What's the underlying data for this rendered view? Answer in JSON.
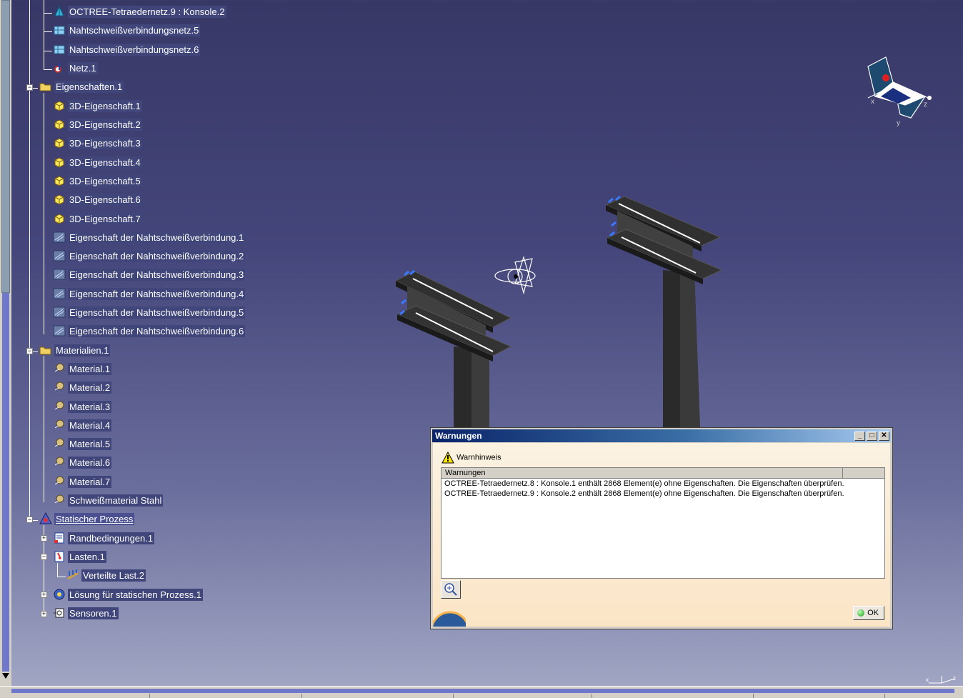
{
  "tree": {
    "items": [
      {
        "label": "OCTREE-Tetraedernetz.9 : Konsole.2",
        "icon": "octree-mesh-icon"
      },
      {
        "label": "Nahtschweißverbindungsnetz.5",
        "icon": "seam-weld-mesh-icon"
      },
      {
        "label": "Nahtschweißverbindungsnetz.6",
        "icon": "seam-weld-mesh-icon"
      },
      {
        "label": "Netz.1",
        "icon": "mesh-icon"
      },
      {
        "label": "Eigenschaften.1",
        "icon": "folder-icon"
      },
      {
        "label": "3D-Eigenschaft.1",
        "icon": "3d-property-icon"
      },
      {
        "label": "3D-Eigenschaft.2",
        "icon": "3d-property-icon"
      },
      {
        "label": "3D-Eigenschaft.3",
        "icon": "3d-property-icon"
      },
      {
        "label": "3D-Eigenschaft.4",
        "icon": "3d-property-icon"
      },
      {
        "label": "3D-Eigenschaft.5",
        "icon": "3d-property-icon"
      },
      {
        "label": "3D-Eigenschaft.6",
        "icon": "3d-property-icon"
      },
      {
        "label": "3D-Eigenschaft.7",
        "icon": "3d-property-icon"
      },
      {
        "label": "Eigenschaft der Nahtschweißverbindung.1",
        "icon": "weld-property-icon"
      },
      {
        "label": "Eigenschaft der Nahtschweißverbindung.2",
        "icon": "weld-property-icon"
      },
      {
        "label": "Eigenschaft der Nahtschweißverbindung.3",
        "icon": "weld-property-icon"
      },
      {
        "label": "Eigenschaft der Nahtschweißverbindung.4",
        "icon": "weld-property-icon"
      },
      {
        "label": "Eigenschaft der Nahtschweißverbindung.5",
        "icon": "weld-property-icon"
      },
      {
        "label": "Eigenschaft der Nahtschweißverbindung.6",
        "icon": "weld-property-icon"
      },
      {
        "label": "Materialien.1",
        "icon": "folder-icon"
      },
      {
        "label": "Material.1",
        "icon": "material-icon"
      },
      {
        "label": "Material.2",
        "icon": "material-icon"
      },
      {
        "label": "Material.3",
        "icon": "material-icon"
      },
      {
        "label": "Material.4",
        "icon": "material-icon"
      },
      {
        "label": "Material.5",
        "icon": "material-icon"
      },
      {
        "label": "Material.6",
        "icon": "material-icon"
      },
      {
        "label": "Material.7",
        "icon": "material-icon"
      },
      {
        "label": "Schweißmaterial Stahl",
        "icon": "material-icon"
      },
      {
        "label": "Statischer Prozess",
        "icon": "static-case-icon"
      },
      {
        "label": "Randbedingungen.1",
        "icon": "restraints-icon"
      },
      {
        "label": "Lasten.1",
        "icon": "loads-icon"
      },
      {
        "label": "Verteilte Last.2",
        "icon": "distributed-load-icon"
      },
      {
        "label": "Lösung für statischen Prozess.1",
        "icon": "solution-icon"
      },
      {
        "label": "Sensoren.1",
        "icon": "sensors-icon"
      }
    ]
  },
  "compass": {
    "x": "x",
    "y": "y",
    "z": "z"
  },
  "axis_mini": {
    "label": "x←z"
  },
  "dialog": {
    "title": "Warnungen",
    "min_btn": "_",
    "max_btn": "□",
    "close_btn": "✕",
    "notice": "Warnhinweis",
    "column": "Warnungen",
    "messages": [
      "OCTREE-Tetraedernetz.8 : Konsole.1 enthält 2868 Element(e) ohne Eigenschaften. Die Eigenschaften überprüfen.",
      "OCTREE-Tetraedernetz.9 : Konsole.2 enthält 2868 Element(e) ohne Eigenschaften. Die Eigenschaften überprüfen."
    ],
    "ok": "OK"
  },
  "colors": {
    "accent": "#0a246a",
    "background_top": "#383867",
    "background_bottom": "#a5a9c6"
  }
}
